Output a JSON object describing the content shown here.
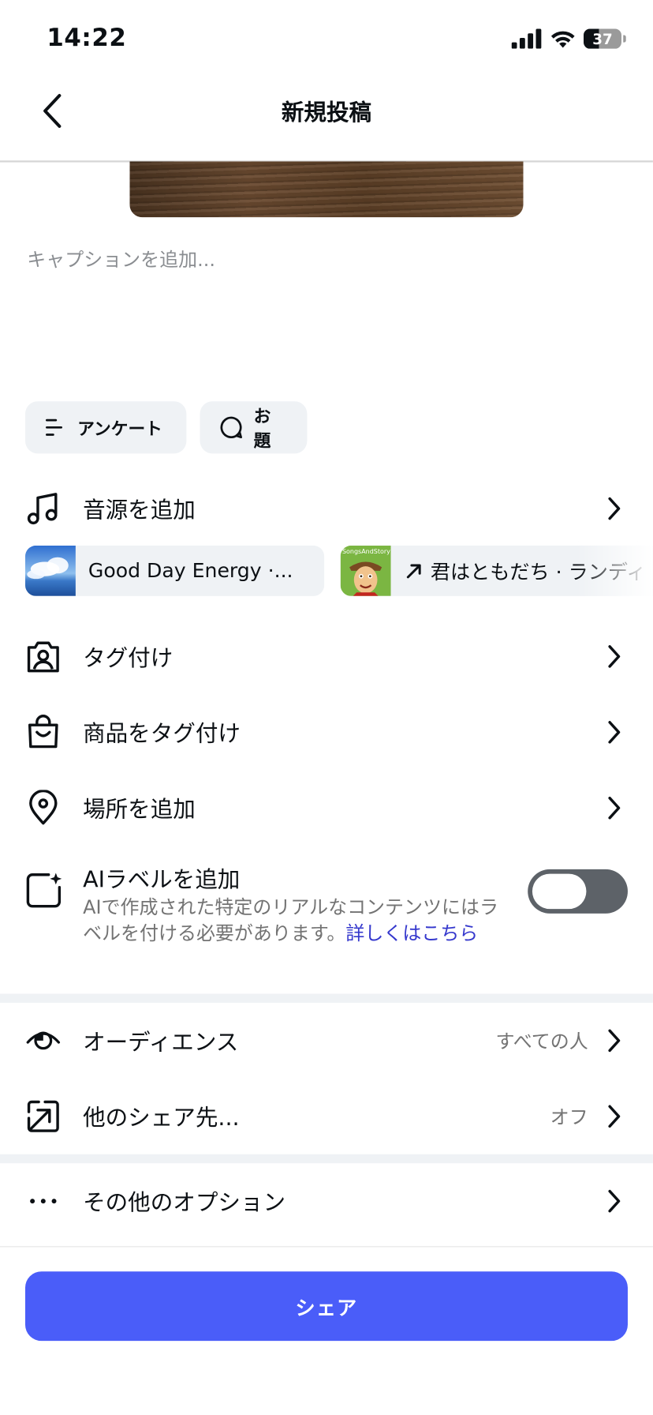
{
  "status_bar": {
    "time": "14:22",
    "battery": "37"
  },
  "header": {
    "title": "新規投稿"
  },
  "caption": {
    "placeholder": "キャプションを追加..."
  },
  "chips": {
    "poll": "アンケート",
    "topic": "お題"
  },
  "music": {
    "label": "音源を追加",
    "suggestions": [
      {
        "title": "Good Day Energy ·..."
      },
      {
        "title": "君はともだち · ランディ"
      }
    ],
    "art_text": "SongsAndStory"
  },
  "rows": {
    "tag_people": "タグ付け",
    "tag_products": "商品をタグ付け",
    "add_location": "場所を追加"
  },
  "ai_label": {
    "title": "AIラベルを追加",
    "description": "AIで作成された特定のリアルなコンテンツにはラベルを付ける必要があります。",
    "link": "詳しくはこちら",
    "enabled": false
  },
  "audience": {
    "label": "オーディエンス",
    "value": "すべての人"
  },
  "share_to": {
    "label": "他のシェア先...",
    "value": "オフ"
  },
  "more_options": {
    "label": "その他のオプション"
  },
  "share_button": {
    "label": "シェア"
  },
  "colors": {
    "accent": "#4a5df9",
    "link": "#3538cd",
    "chip_bg": "#eff2f5",
    "toggle_off": "#5d6268"
  }
}
